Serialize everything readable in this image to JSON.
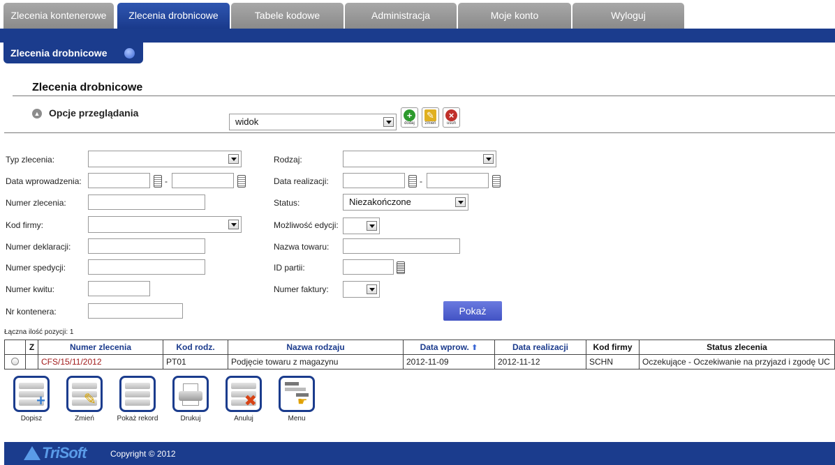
{
  "tabs": [
    {
      "label": "Zlecenia kontenerowe",
      "active": false
    },
    {
      "label": "Zlecenia drobnicowe",
      "active": true
    },
    {
      "label": "Tabele kodowe",
      "active": false
    },
    {
      "label": "Administracja",
      "active": false
    },
    {
      "label": "Moje konto",
      "active": false
    },
    {
      "label": "Wyloguj",
      "active": false
    }
  ],
  "section_tab": "Zlecenia drobnicowe",
  "page_title": "Zlecenia drobnicowe",
  "options": {
    "label": "Opcje przeglądania",
    "view_value": "widok",
    "add": "dodaj",
    "edit": "zmień",
    "delete": "usuń"
  },
  "filters": {
    "typ_zlecenia": "Typ zlecenia:",
    "data_wprowadzenia": "Data wprowadzenia:",
    "numer_zlecenia": "Numer zlecenia:",
    "kod_firmy": "Kod firmy:",
    "numer_deklaracji": "Numer deklaracji:",
    "numer_spedycji": "Numer spedycji:",
    "numer_kwitu": "Numer kwitu:",
    "nr_kontenera": "Nr kontenera:",
    "rodzaj": "Rodzaj:",
    "data_realizacji": "Data realizacji:",
    "status": "Status:",
    "status_value": "Niezakończone",
    "mozliwosc_edycji": "Możliwość edycji:",
    "nazwa_towaru": "Nazwa towaru:",
    "id_partii": "ID partii:",
    "numer_faktury": "Numer faktury:",
    "dash": "-"
  },
  "show_button": "Pokaż",
  "count_label": "Łączna ilość pozycji: 1",
  "table": {
    "headers": [
      "",
      "Z",
      "Numer zlecenia",
      "Kod rodz.",
      "Nazwa rodzaju",
      "Data wprow.",
      "Data realizacji",
      "Kod firmy",
      "Status zlecenia"
    ],
    "sort_icon": "up-arrow-icon",
    "rows": [
      [
        "",
        "",
        "CFS/15/11/2012",
        "PT01",
        "Podjęcie towaru z magazynu",
        "2012-11-09",
        "2012-11-12",
        "SCHN",
        "Oczekujące - Oczekiwanie na przyjazd i zgodę UC"
      ]
    ]
  },
  "toolbar": [
    "Dopisz",
    "Zmień",
    "Pokaż rekord",
    "Drukuj",
    "Anuluj",
    "Menu"
  ],
  "footer": {
    "logo": "TriSoft",
    "copyright": "Copyright © 2012"
  },
  "colors": {
    "brand_blue": "#1b3c8d",
    "tab_grey": "#8a8a8a",
    "button_blue": "#4f5fd0",
    "link_red": "#a11a1a"
  }
}
